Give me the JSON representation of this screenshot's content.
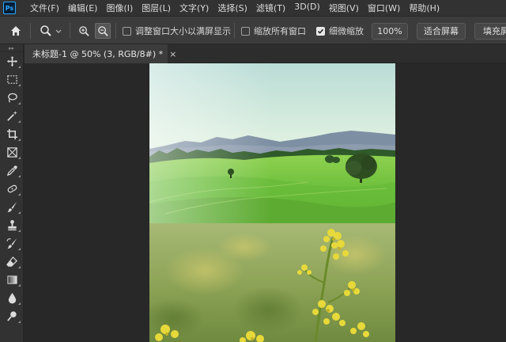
{
  "app": {
    "logo_text": "Ps",
    "accent": "#31a8ff",
    "logo_bg": "#001e36"
  },
  "menu": {
    "items": [
      "文件(F)",
      "编辑(E)",
      "图像(I)",
      "图层(L)",
      "文字(Y)",
      "选择(S)",
      "滤镜(T)",
      "3D(D)",
      "视图(V)",
      "窗口(W)",
      "帮助(H)"
    ]
  },
  "options": {
    "home_icon": "home-icon",
    "tool_icon": "zoom-tool-icon",
    "zoom_in_icon": "zoom-in-icon",
    "zoom_out_icon": "zoom-out-icon",
    "resize_windows_label": "调整窗口大小以满屏显示",
    "resize_windows_checked": false,
    "zoom_all_label": "缩放所有窗口",
    "zoom_all_checked": false,
    "scrubby_zoom_label": "细微缩放",
    "scrubby_zoom_checked": true,
    "zoom_percent": "100%",
    "fit_screen_label": "适合屏幕",
    "fill_screen_label": "填充屏"
  },
  "document": {
    "tab_title": "未标题-1 @ 50% (3, RGB/8#) *",
    "close_symbol": "×"
  },
  "tools": [
    "move-tool-icon",
    "marquee-tool-icon",
    "lasso-tool-icon",
    "magic-wand-tool-icon",
    "crop-tool-icon",
    "frame-tool-icon",
    "eyedropper-tool-icon",
    "healing-brush-tool-icon",
    "brush-tool-icon",
    "clone-stamp-tool-icon",
    "history-brush-tool-icon",
    "eraser-tool-icon",
    "gradient-tool-icon",
    "blur-tool-icon",
    "dodge-tool-icon"
  ],
  "colors": {
    "menubar_bg": "#323232",
    "options_bg": "#3c3c3c",
    "canvas_bg": "#282828"
  }
}
